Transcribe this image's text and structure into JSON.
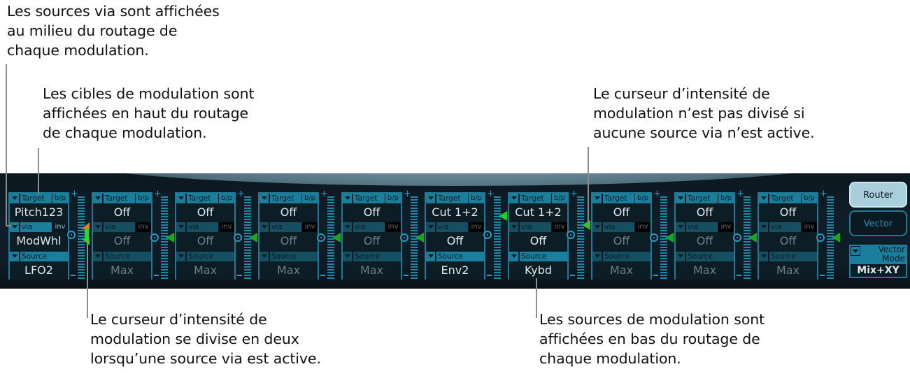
{
  "callouts": {
    "via_sources": "Les sources via sont affichées\nau milieu du routage de\nchaque modulation.",
    "targets": "Les cibles de modulation sont\naffichées en haut du routage\nde chaque modulation.",
    "no_split": "Le curseur d’intensité de\nmodulation n’est pas divisé si\naucune source via n’est active.",
    "split": "Le curseur d’intensité de\nmodulation se divise en deux\nlorsqu’une source via est active.",
    "sources": "Les sources de modulation sont\naffichées en bas du routage de\nchaque modulation."
  },
  "headers": {
    "target": "Target",
    "bp": "b/p",
    "via": "via",
    "inv": "inv",
    "source": "Source"
  },
  "slots": [
    {
      "target": "Pitch123",
      "via": "ModWhl",
      "source": "LFO2",
      "state": "split"
    },
    {
      "target": "Off",
      "via": "Off",
      "source": "Max",
      "state": "off"
    },
    {
      "target": "Off",
      "via": "Off",
      "source": "Max",
      "state": "off"
    },
    {
      "target": "Off",
      "via": "Off",
      "source": "Max",
      "state": "off"
    },
    {
      "target": "Off",
      "via": "Off",
      "source": "Max",
      "state": "off"
    },
    {
      "target": "Cut 1+2",
      "via": "Off",
      "source": "Env2",
      "state": "high"
    },
    {
      "target": "Cut 1+2",
      "via": "Off",
      "source": "Kybd",
      "state": "mid"
    },
    {
      "target": "Off",
      "via": "Off",
      "source": "Max",
      "state": "off"
    },
    {
      "target": "Off",
      "via": "Off",
      "source": "Max",
      "state": "off"
    },
    {
      "target": "Off",
      "via": "Off",
      "source": "Max",
      "state": "off"
    }
  ],
  "buttons": {
    "router": "Router",
    "vector": "Vector"
  },
  "vector_mode": {
    "label": "Vector\nMode",
    "value": "Mix+XY"
  },
  "colors": {
    "accent": "#1a7f9c",
    "intensity_arrow": "#22cc22",
    "via_arrow": "#f07d12",
    "panel_bg": "#0d1a23"
  }
}
